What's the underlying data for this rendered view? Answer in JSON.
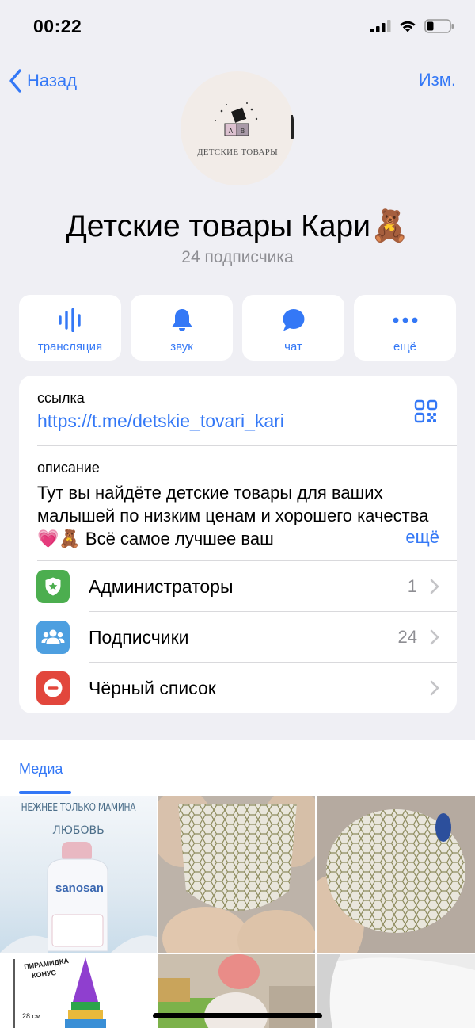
{
  "status": {
    "time": "00:22"
  },
  "nav": {
    "back_label": "Назад",
    "edit_label": "Изм."
  },
  "avatar": {
    "text": "ДЕТСКИЕ ТОВАРЫ"
  },
  "channel": {
    "title": "Детские товары Кари🧸",
    "subscribers": "24 подписчика"
  },
  "actions": [
    {
      "label": "трансляция",
      "icon": "broadcast-icon"
    },
    {
      "label": "звук",
      "icon": "bell-icon"
    },
    {
      "label": "чат",
      "icon": "chat-bubble-icon"
    },
    {
      "label": "ещё",
      "icon": "more-dots-icon"
    }
  ],
  "info": {
    "link_label": "ссылка",
    "link_value": "https://t.me/detskie_tovari_kari",
    "description_label": "описание",
    "description_value": "Тут вы найдёте детские товары для ваших малышей по низким ценам и хорошего качества💗🧸 Всё самое лучшее ваш",
    "more_label": "ещё"
  },
  "list": [
    {
      "label": "Администраторы",
      "value": "1",
      "icon": "admin-shield-icon",
      "color": "#4cae4f"
    },
    {
      "label": "Подписчики",
      "value": "24",
      "icon": "people-icon",
      "color": "#4d9fe0"
    },
    {
      "label": "Чёрный список",
      "value": "",
      "icon": "blocked-icon",
      "color": "#e2463c"
    }
  ],
  "media": {
    "tab_label": "Медиа",
    "thumb1_caption_line1": "НЕЖНЕЕ ТОЛЬКО МАМИНА",
    "thumb1_caption_line2": "ЛЮБОВЬ",
    "thumb1_brand": "sanosan",
    "thumb4_caption_line1": "ПИРАМИДКА",
    "thumb4_caption_line2": "КОНУС",
    "thumb4_size": "28 см"
  },
  "colors": {
    "accent": "#3478f6",
    "background": "#efeff4"
  }
}
